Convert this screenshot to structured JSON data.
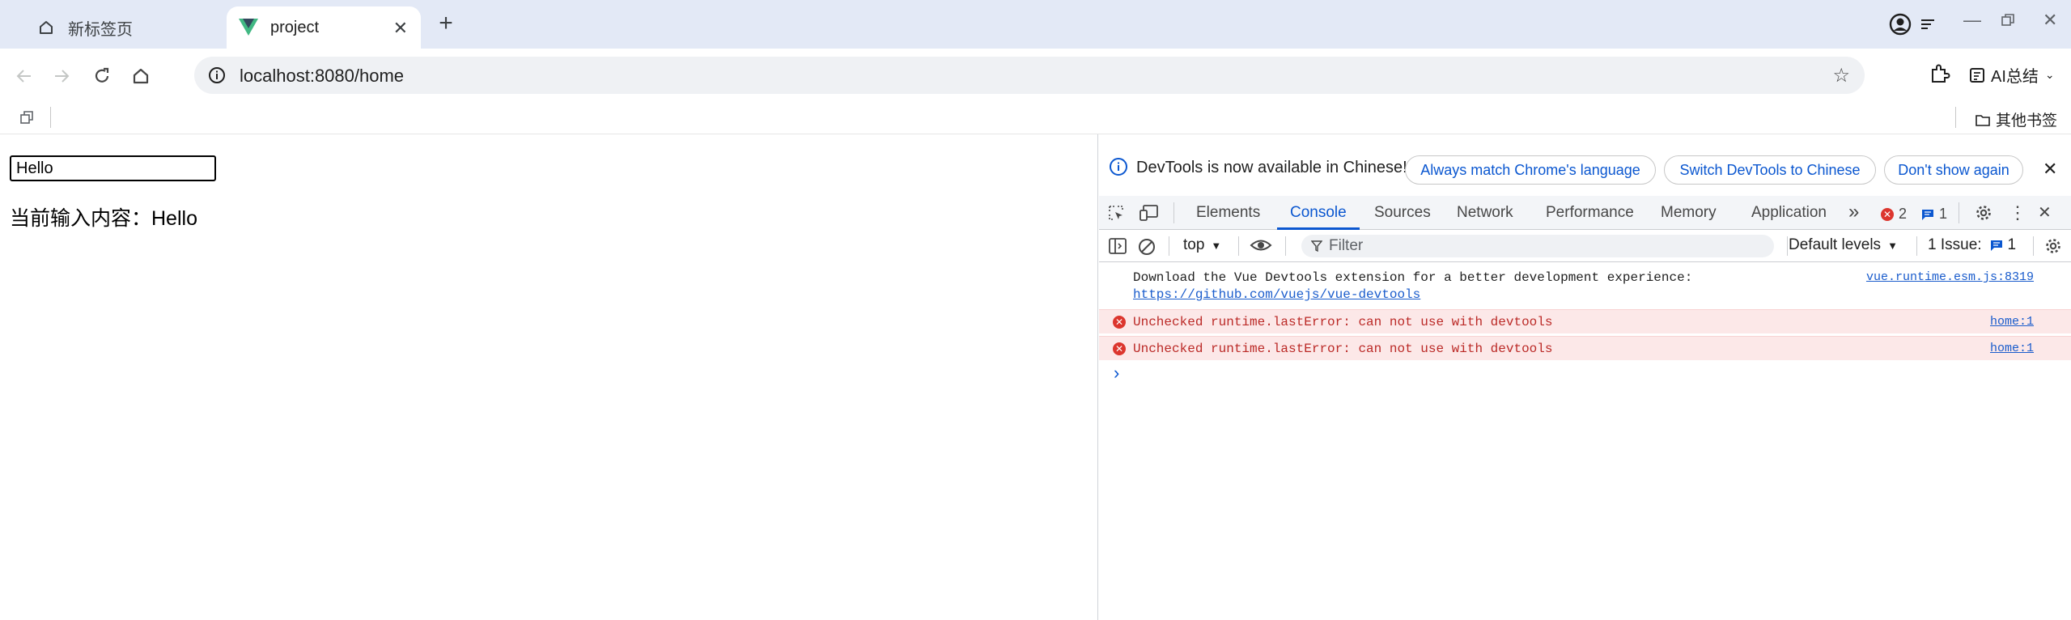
{
  "tabs": [
    {
      "title": "新标签页"
    },
    {
      "title": "project"
    }
  ],
  "omnibox": {
    "url": "localhost:8080/home"
  },
  "ai_button": {
    "label": "AI总结"
  },
  "bookmarks": {
    "other_label": "其他书签"
  },
  "page": {
    "input_value": "Hello",
    "output_label": "当前输入内容：Hello"
  },
  "devtools": {
    "infobar": {
      "message": "DevTools is now available in Chinese!",
      "buttons": [
        "Always match Chrome's language",
        "Switch DevTools to Chinese",
        "Don't show again"
      ]
    },
    "tabs": [
      "Elements",
      "Console",
      "Sources",
      "Network",
      "Performance",
      "Memory",
      "Application"
    ],
    "active_tab": "Console",
    "error_count": "2",
    "message_count": "1",
    "context": "top",
    "filter_placeholder": "Filter",
    "levels": "Default levels",
    "issues_label": "1 Issue:",
    "issues_count": "1",
    "messages": [
      {
        "type": "info",
        "text": "Download the Vue Devtools extension for a better development experience:",
        "link": "https://github.com/vuejs/vue-devtools",
        "source": "vue.runtime.esm.js:8319"
      },
      {
        "type": "error",
        "text": "Unchecked runtime.lastError: can not use with devtools",
        "source": "home:1"
      },
      {
        "type": "error",
        "text": "Unchecked runtime.lastError: can not use with devtools",
        "source": "home:1"
      }
    ],
    "prompt_symbol": "›"
  },
  "colors": {
    "tabstrip": "#e3e9f6",
    "accent": "#0b57d0",
    "error": "#dc362e",
    "error_bg": "#fce8e8"
  }
}
